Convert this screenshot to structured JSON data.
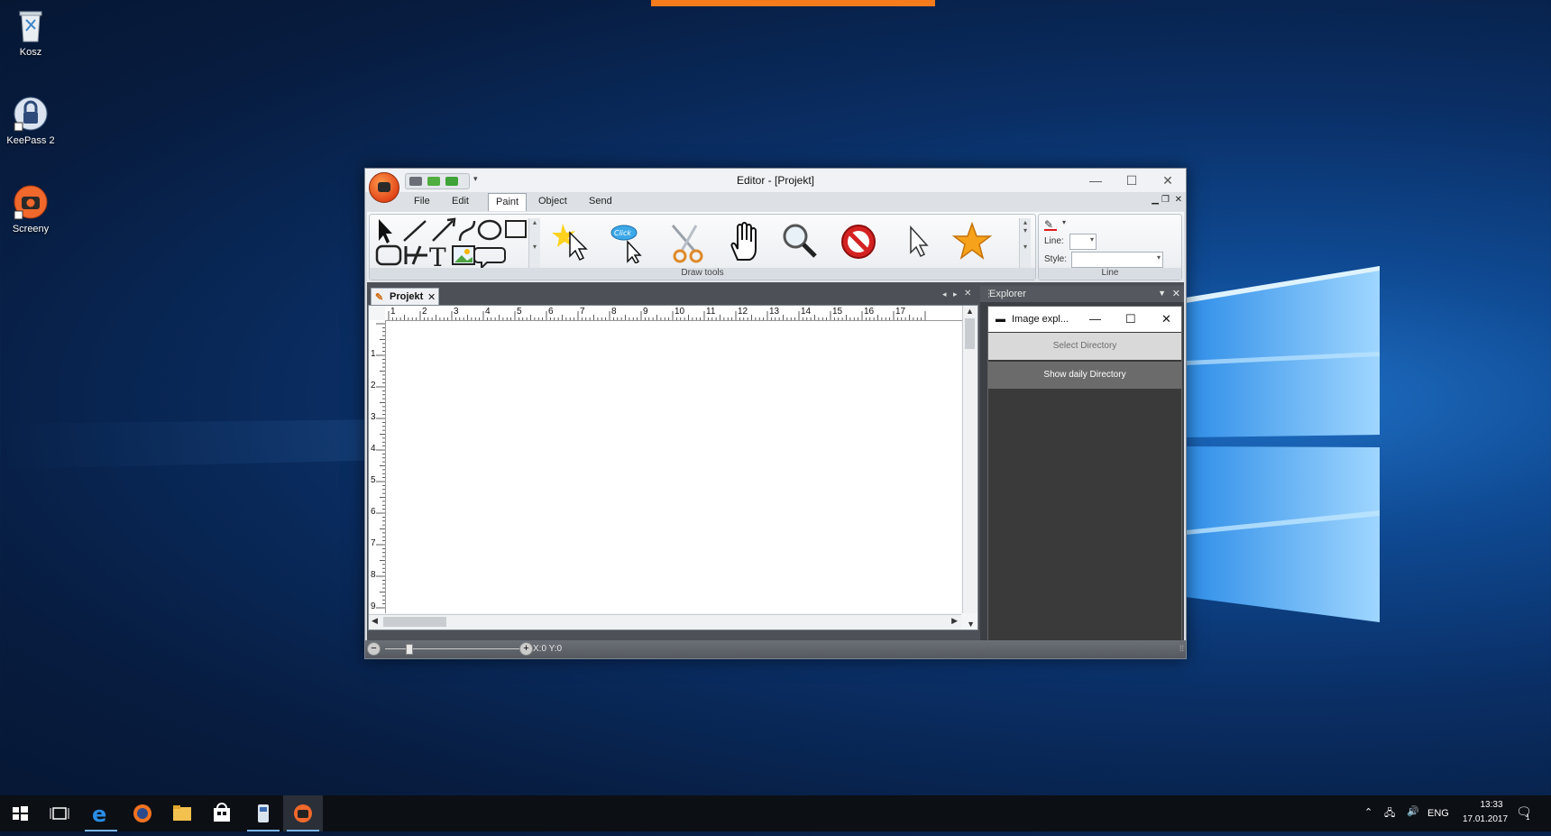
{
  "desktop": {
    "icons": [
      {
        "label": "Kosz",
        "icon": "recycle-bin-icon"
      },
      {
        "label": "KeePass 2",
        "icon": "keepass-icon"
      },
      {
        "label": "Screeny",
        "icon": "screeny-icon"
      }
    ]
  },
  "editor": {
    "title": "Editor - [Projekt]",
    "menu": [
      "File",
      "Edit",
      "Paint",
      "Object",
      "Send"
    ],
    "active_menu": "Paint",
    "ribbon": {
      "draw_tools_label": "Draw tools",
      "line_group_label": "Line",
      "line_label": "Line:",
      "style_label": "Style:",
      "tools": [
        "highlight-cursor-icon",
        "click-bubble-icon",
        "scissors-icon",
        "hand-icon",
        "magnifier-icon",
        "no-entry-icon",
        "pointer-icon",
        "star-icon"
      ]
    },
    "document_tab": "Projekt",
    "ruler_h": [
      "1",
      "2",
      "3",
      "4",
      "5",
      "6",
      "7",
      "8",
      "9",
      "10",
      "11",
      "12",
      "13",
      "14",
      "15",
      "16",
      "17"
    ],
    "ruler_v": [
      "1",
      "2",
      "3",
      "4",
      "5",
      "6",
      "7",
      "8",
      "9"
    ],
    "status_coords": "X:0 Y:0",
    "explorer": {
      "title": "Explorer",
      "subwindow_title": "Image expl...",
      "select_directory": "Select Directory",
      "show_daily_directory": "Show daily Directory"
    }
  },
  "taskbar": {
    "language": "ENG",
    "time": "13:33",
    "date": "17.01.2017",
    "notification_count": "1"
  },
  "colors": {
    "accent_orange": "#f47c1c",
    "taskbar_bg": "#0c0f14"
  }
}
